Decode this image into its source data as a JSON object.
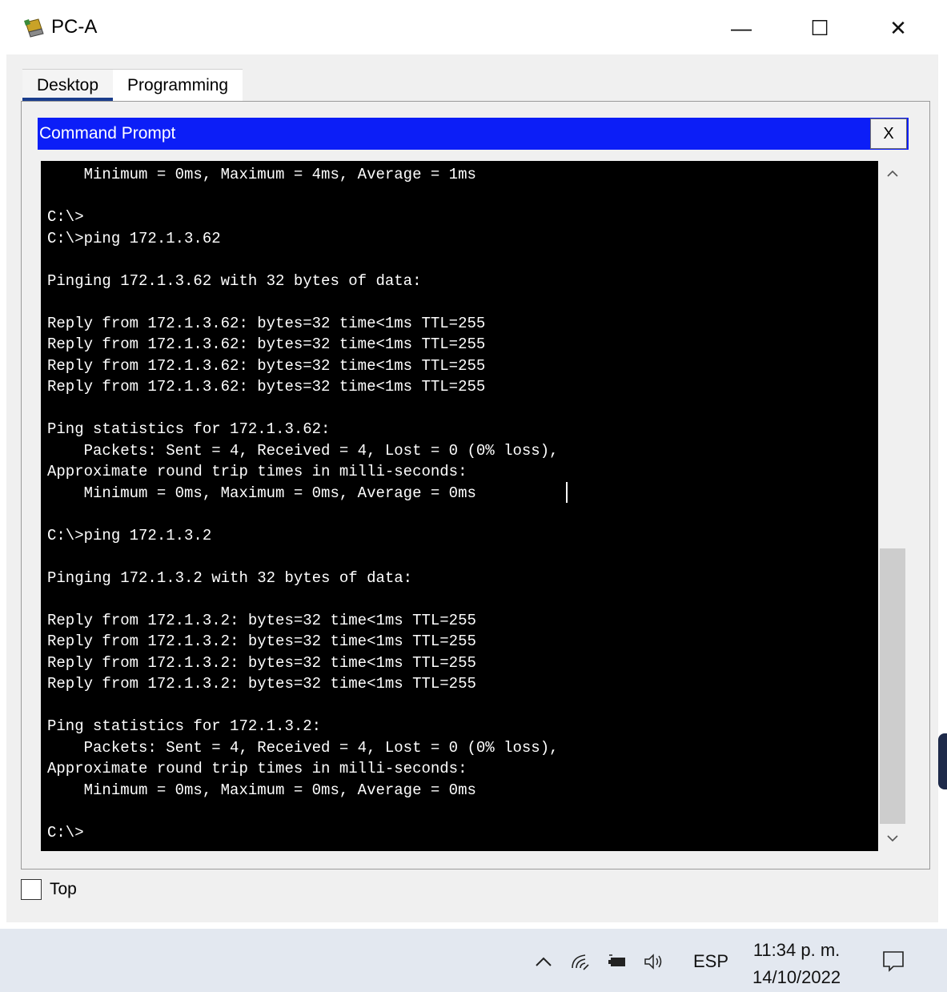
{
  "window": {
    "title": "PC-A"
  },
  "controls": {
    "minimize": "—",
    "maximize": "☐",
    "close": "✕"
  },
  "tabs": [
    {
      "label": "Desktop",
      "active": true
    },
    {
      "label": "Programming",
      "active": false
    }
  ],
  "command_prompt": {
    "title": "Command Prompt",
    "close_label": "X",
    "lines": [
      "    Minimum = 0ms, Maximum = 4ms, Average = 1ms",
      "",
      "C:\\>",
      "C:\\>ping 172.1.3.62",
      "",
      "Pinging 172.1.3.62 with 32 bytes of data:",
      "",
      "Reply from 172.1.3.62: bytes=32 time<1ms TTL=255",
      "Reply from 172.1.3.62: bytes=32 time<1ms TTL=255",
      "Reply from 172.1.3.62: bytes=32 time<1ms TTL=255",
      "Reply from 172.1.3.62: bytes=32 time<1ms TTL=255",
      "",
      "Ping statistics for 172.1.3.62:",
      "    Packets: Sent = 4, Received = 4, Lost = 0 (0% loss),",
      "Approximate round trip times in milli-seconds:",
      "    Minimum = 0ms, Maximum = 0ms, Average = 0ms",
      "",
      "C:\\>ping 172.1.3.2",
      "",
      "Pinging 172.1.3.2 with 32 bytes of data:",
      "",
      "Reply from 172.1.3.2: bytes=32 time<1ms TTL=255",
      "Reply from 172.1.3.2: bytes=32 time<1ms TTL=255",
      "Reply from 172.1.3.2: bytes=32 time<1ms TTL=255",
      "Reply from 172.1.3.2: bytes=32 time<1ms TTL=255",
      "",
      "Ping statistics for 172.1.3.2:",
      "    Packets: Sent = 4, Received = 4, Lost = 0 (0% loss),",
      "Approximate round trip times in milli-seconds:",
      "    Minimum = 0ms, Maximum = 0ms, Average = 0ms",
      "",
      "C:\\>"
    ],
    "background": "#000000",
    "text_color": "#ffffff"
  },
  "top_checkbox": {
    "label": "Top",
    "checked": false
  },
  "taskbar": {
    "tray_icons": [
      "chevron-up-icon",
      "wifi-icon",
      "battery-icon",
      "volume-icon"
    ],
    "language": "ESP",
    "time": "11:34 p. m.",
    "date": "14/10/2022",
    "notification_icon": "notification-icon"
  },
  "colors": {
    "header_blue": "#0c1ef7",
    "tab_underline": "#1a3d8c"
  }
}
